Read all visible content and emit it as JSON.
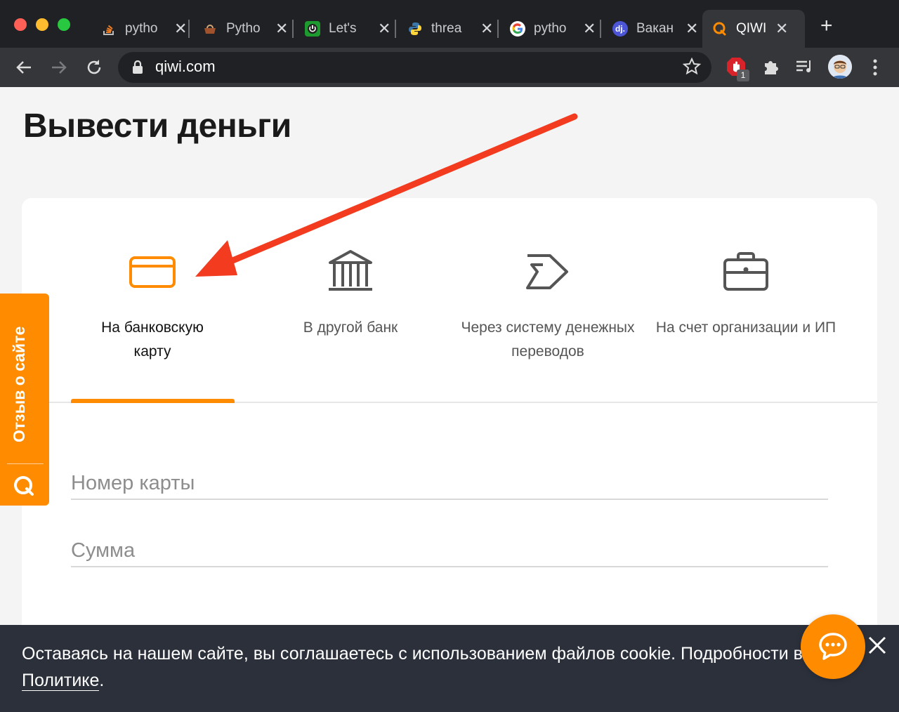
{
  "browser": {
    "tabs": [
      {
        "title": "pytho",
        "favicon": "stackoverflow-icon",
        "close": "✕"
      },
      {
        "title": "Pytho",
        "favicon": "python-basket-icon",
        "close": "✕"
      },
      {
        "title": "Let's",
        "favicon": "power-icon",
        "close": "✕"
      },
      {
        "title": "threa",
        "favicon": "python-icon",
        "close": "✕"
      },
      {
        "title": "pytho",
        "favicon": "google-icon",
        "close": "✕"
      },
      {
        "title": "Вакан",
        "favicon": "django-icon",
        "favicon_text": "dj.",
        "close": "✕"
      },
      {
        "title": "QIWI",
        "favicon": "qiwi-icon",
        "close": "✕",
        "active": true
      }
    ],
    "new_tab": "+",
    "url": "qiwi.com",
    "extension_badge": "1"
  },
  "page": {
    "title": "Вывести деньги",
    "methods": [
      {
        "label": "На банковскую карту",
        "icon": "bank-card-icon",
        "active": true
      },
      {
        "label": "В другой банк",
        "icon": "bank-building-icon",
        "active": false
      },
      {
        "label": "Через систему денежных переводов",
        "icon": "money-transfer-icon",
        "active": false
      },
      {
        "label": "На счет организации и ИП",
        "icon": "briefcase-icon",
        "active": false
      }
    ],
    "fields": {
      "card_number_placeholder": "Номер карты",
      "amount_placeholder": "Сумма"
    }
  },
  "feedback": {
    "label": "Отзыв о сайте"
  },
  "cookie": {
    "text": "Оставаясь на нашем сайте, вы соглашаетесь с использованием файлов cookie. Подробности в",
    "link": "Политике",
    "tail": "."
  },
  "colors": {
    "accent": "#ff8c00",
    "cookie_bg": "#2b303b",
    "arrow": "#f23b1f"
  }
}
